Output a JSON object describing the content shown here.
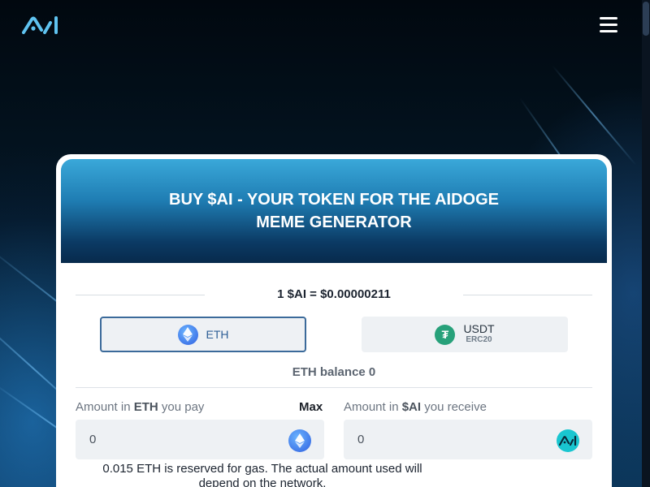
{
  "header": {
    "logo_icon": "aidoge-logo-icon",
    "menu_icon": "hamburger-menu-icon"
  },
  "card": {
    "title": "BUY $AI - YOUR TOKEN FOR THE AIDOGE MEME GENERATOR",
    "price": "1 $AI = $0.00000211",
    "tokens": {
      "eth": {
        "label": "ETH",
        "icon": "eth-icon",
        "selected": true
      },
      "usdt": {
        "label": "USDT",
        "sublabel": "ERC20",
        "icon": "usdt-icon"
      }
    },
    "balance": "ETH balance 0",
    "pay": {
      "label_prefix": "Amount in ",
      "label_token": "ETH",
      "label_suffix": " you pay",
      "max_label": "Max",
      "value": "0",
      "icon": "eth-icon"
    },
    "receive": {
      "label_prefix": "Amount in ",
      "label_token": "$AI",
      "label_suffix": " you receive",
      "value": "0",
      "icon": "ai-token-icon"
    },
    "gas_note": "0.015 ETH is reserved for gas. The actual amount used will depend on the network."
  },
  "colors": {
    "accent": "#2e5f96",
    "eth_blue": "#2f5fe0",
    "usdt_green": "#27a17a",
    "ai_teal": "#19c6d0"
  }
}
